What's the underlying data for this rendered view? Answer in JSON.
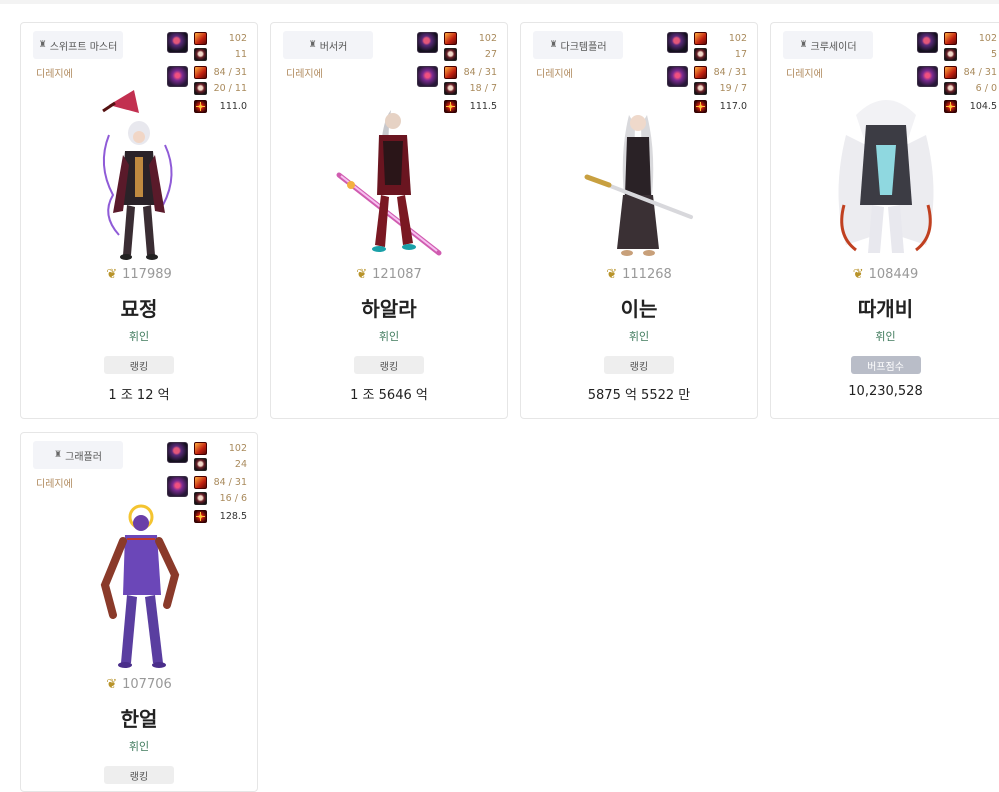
{
  "colors": {
    "role": "#b08a5e",
    "adventure": "#3f7a5c",
    "fame_icon": "#b8932a",
    "buff_badge": "#b9bdc8"
  },
  "cards": [
    {
      "job": "스위프트 마스터",
      "role": "디레지에",
      "eq1": "102",
      "eq2": "11",
      "eq3": "84 / 31",
      "eq4": "20 / 11",
      "eq5": "111.0",
      "fame": "117989",
      "name": "묘정",
      "adventure": "휘인",
      "badge": "랭킹",
      "score": "1 조 12 억"
    },
    {
      "job": "버서커",
      "role": "디레지에",
      "eq1": "102",
      "eq2": "27",
      "eq3": "84 / 31",
      "eq4": "18 / 7",
      "eq5": "111.5",
      "fame": "121087",
      "name": "하알라",
      "adventure": "휘인",
      "badge": "랭킹",
      "score": "1 조 5646 억"
    },
    {
      "job": "다크템플러",
      "role": "디레지에",
      "eq1": "102",
      "eq2": "17",
      "eq3": "84 / 31",
      "eq4": "19 / 7",
      "eq5": "117.0",
      "fame": "111268",
      "name": "이는",
      "adventure": "휘인",
      "badge": "랭킹",
      "score": "5875 억 5522 만"
    },
    {
      "job": "크루세이더",
      "role": "디레지에",
      "eq1": "102",
      "eq2": "5",
      "eq3": "84 / 31",
      "eq4": "6 / 0",
      "eq5": "104.5",
      "fame": "108449",
      "name": "따개비",
      "adventure": "휘인",
      "badge": "버프점수",
      "score": "10,230,528"
    },
    {
      "job": "그래플러",
      "role": "디레지에",
      "eq1": "102",
      "eq2": "24",
      "eq3": "84 / 31",
      "eq4": "16 / 6",
      "eq5": "128.5",
      "fame": "107706",
      "name": "한얼",
      "adventure": "휘인",
      "badge": "랭킹",
      "score": ""
    }
  ],
  "icons": {
    "job": "tower-icon",
    "fame": "laurel-medal-icon"
  }
}
